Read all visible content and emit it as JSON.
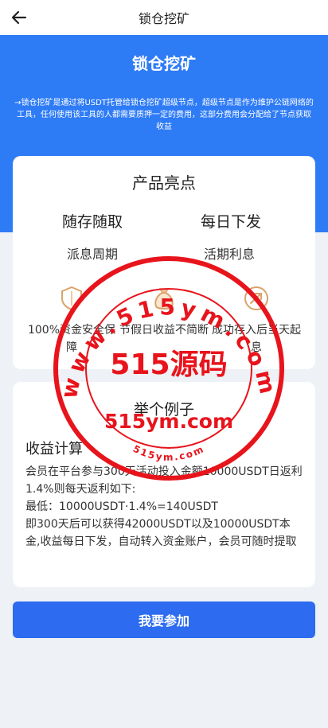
{
  "topbar": {
    "title": "锁仓挖矿",
    "back_icon": "arrow-left-icon"
  },
  "hero": {
    "title": "锁仓挖矿",
    "description": "→锁仓挖矿是通过将USDT托管给锁仓挖矿超级节点，超级节点是作为维护公链网络的工具，任何使用该工具的人都需要质押一定的费用，这部分费用会分配给了节点获取收益"
  },
  "highlights": {
    "title": "产品亮点",
    "big": [
      "随存随取",
      "每日下发"
    ],
    "mid": [
      "派息周期",
      "活期利息"
    ],
    "features": [
      {
        "icon": "shield-icon",
        "text": "100%资金安全保障"
      },
      {
        "icon": "money-bag-icon",
        "text": "节假日收益不简断"
      },
      {
        "icon": "growth-arrow-icon",
        "text": "成功存入后当天起息"
      }
    ]
  },
  "example": {
    "title": "举个例子",
    "subtitle": "收益计算",
    "lines": [
      "会员在平台参与300天活动投入金额10000USDT日返利1.4%则每天返利如下:",
      "最低：10000USDT·1.4%=140USDT",
      "即300天后可以获得42000USDT以及10000USDT本金,收益每日下发，自动转入资金账户，会员可随时提取"
    ]
  },
  "join_button": "我要参加",
  "watermark": {
    "top_arc": "www.515ym.com",
    "center": "515源码",
    "domain": "515ym.com",
    "bottom_arc": "515ym.com",
    "color": "#e8141c"
  }
}
